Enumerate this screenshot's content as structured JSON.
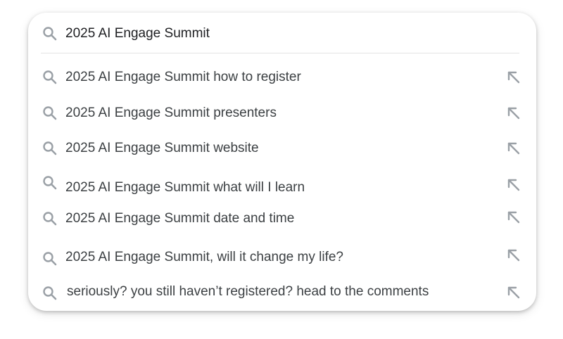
{
  "search": {
    "query": "2025 AI Engage Summit",
    "icon": "search-icon"
  },
  "suggestions": [
    {
      "label": "2025 AI Engage Summit how to register",
      "icon": "search-icon",
      "action_icon": "arrow-up-left-icon"
    },
    {
      "label": "2025 AI Engage Summit presenters",
      "icon": "search-icon",
      "action_icon": "arrow-up-left-icon"
    },
    {
      "label": "2025 AI Engage Summit website",
      "icon": "search-icon",
      "action_icon": "arrow-up-left-icon"
    },
    {
      "label": "2025 AI Engage Summit what will I learn",
      "icon": "search-icon",
      "action_icon": "arrow-up-left-icon"
    },
    {
      "label": "2025 AI Engage Summit date and time",
      "icon": "search-icon",
      "action_icon": "arrow-up-left-icon"
    },
    {
      "label": "2025 AI Engage Summit, will it change my life?",
      "icon": "search-icon",
      "action_icon": "arrow-up-left-icon"
    },
    {
      "label": "seriously? you still haven’t registered? head to the comments",
      "icon": "search-icon",
      "action_icon": "arrow-up-left-icon"
    }
  ],
  "colors": {
    "icon_gray": "#9aa0a6",
    "text": "#3c4043",
    "query_text": "#202124"
  }
}
